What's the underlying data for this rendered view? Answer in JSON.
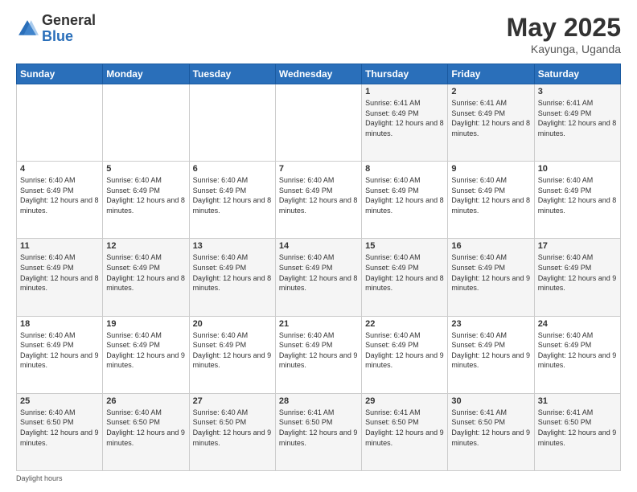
{
  "header": {
    "logo_general": "General",
    "logo_blue": "Blue",
    "title": "May 2025",
    "location": "Kayunga, Uganda"
  },
  "days_of_week": [
    "Sunday",
    "Monday",
    "Tuesday",
    "Wednesday",
    "Thursday",
    "Friday",
    "Saturday"
  ],
  "weeks": [
    [
      {
        "day": "",
        "info": ""
      },
      {
        "day": "",
        "info": ""
      },
      {
        "day": "",
        "info": ""
      },
      {
        "day": "",
        "info": ""
      },
      {
        "day": "1",
        "info": "Sunrise: 6:41 AM\nSunset: 6:49 PM\nDaylight: 12 hours and 8 minutes."
      },
      {
        "day": "2",
        "info": "Sunrise: 6:41 AM\nSunset: 6:49 PM\nDaylight: 12 hours and 8 minutes."
      },
      {
        "day": "3",
        "info": "Sunrise: 6:41 AM\nSunset: 6:49 PM\nDaylight: 12 hours and 8 minutes."
      }
    ],
    [
      {
        "day": "4",
        "info": "Sunrise: 6:40 AM\nSunset: 6:49 PM\nDaylight: 12 hours and 8 minutes."
      },
      {
        "day": "5",
        "info": "Sunrise: 6:40 AM\nSunset: 6:49 PM\nDaylight: 12 hours and 8 minutes."
      },
      {
        "day": "6",
        "info": "Sunrise: 6:40 AM\nSunset: 6:49 PM\nDaylight: 12 hours and 8 minutes."
      },
      {
        "day": "7",
        "info": "Sunrise: 6:40 AM\nSunset: 6:49 PM\nDaylight: 12 hours and 8 minutes."
      },
      {
        "day": "8",
        "info": "Sunrise: 6:40 AM\nSunset: 6:49 PM\nDaylight: 12 hours and 8 minutes."
      },
      {
        "day": "9",
        "info": "Sunrise: 6:40 AM\nSunset: 6:49 PM\nDaylight: 12 hours and 8 minutes."
      },
      {
        "day": "10",
        "info": "Sunrise: 6:40 AM\nSunset: 6:49 PM\nDaylight: 12 hours and 8 minutes."
      }
    ],
    [
      {
        "day": "11",
        "info": "Sunrise: 6:40 AM\nSunset: 6:49 PM\nDaylight: 12 hours and 8 minutes."
      },
      {
        "day": "12",
        "info": "Sunrise: 6:40 AM\nSunset: 6:49 PM\nDaylight: 12 hours and 8 minutes."
      },
      {
        "day": "13",
        "info": "Sunrise: 6:40 AM\nSunset: 6:49 PM\nDaylight: 12 hours and 8 minutes."
      },
      {
        "day": "14",
        "info": "Sunrise: 6:40 AM\nSunset: 6:49 PM\nDaylight: 12 hours and 8 minutes."
      },
      {
        "day": "15",
        "info": "Sunrise: 6:40 AM\nSunset: 6:49 PM\nDaylight: 12 hours and 8 minutes."
      },
      {
        "day": "16",
        "info": "Sunrise: 6:40 AM\nSunset: 6:49 PM\nDaylight: 12 hours and 9 minutes."
      },
      {
        "day": "17",
        "info": "Sunrise: 6:40 AM\nSunset: 6:49 PM\nDaylight: 12 hours and 9 minutes."
      }
    ],
    [
      {
        "day": "18",
        "info": "Sunrise: 6:40 AM\nSunset: 6:49 PM\nDaylight: 12 hours and 9 minutes."
      },
      {
        "day": "19",
        "info": "Sunrise: 6:40 AM\nSunset: 6:49 PM\nDaylight: 12 hours and 9 minutes."
      },
      {
        "day": "20",
        "info": "Sunrise: 6:40 AM\nSunset: 6:49 PM\nDaylight: 12 hours and 9 minutes."
      },
      {
        "day": "21",
        "info": "Sunrise: 6:40 AM\nSunset: 6:49 PM\nDaylight: 12 hours and 9 minutes."
      },
      {
        "day": "22",
        "info": "Sunrise: 6:40 AM\nSunset: 6:49 PM\nDaylight: 12 hours and 9 minutes."
      },
      {
        "day": "23",
        "info": "Sunrise: 6:40 AM\nSunset: 6:49 PM\nDaylight: 12 hours and 9 minutes."
      },
      {
        "day": "24",
        "info": "Sunrise: 6:40 AM\nSunset: 6:49 PM\nDaylight: 12 hours and 9 minutes."
      }
    ],
    [
      {
        "day": "25",
        "info": "Sunrise: 6:40 AM\nSunset: 6:50 PM\nDaylight: 12 hours and 9 minutes."
      },
      {
        "day": "26",
        "info": "Sunrise: 6:40 AM\nSunset: 6:50 PM\nDaylight: 12 hours and 9 minutes."
      },
      {
        "day": "27",
        "info": "Sunrise: 6:40 AM\nSunset: 6:50 PM\nDaylight: 12 hours and 9 minutes."
      },
      {
        "day": "28",
        "info": "Sunrise: 6:41 AM\nSunset: 6:50 PM\nDaylight: 12 hours and 9 minutes."
      },
      {
        "day": "29",
        "info": "Sunrise: 6:41 AM\nSunset: 6:50 PM\nDaylight: 12 hours and 9 minutes."
      },
      {
        "day": "30",
        "info": "Sunrise: 6:41 AM\nSunset: 6:50 PM\nDaylight: 12 hours and 9 minutes."
      },
      {
        "day": "31",
        "info": "Sunrise: 6:41 AM\nSunset: 6:50 PM\nDaylight: 12 hours and 9 minutes."
      }
    ]
  ],
  "footer": {
    "note": "Daylight hours"
  }
}
